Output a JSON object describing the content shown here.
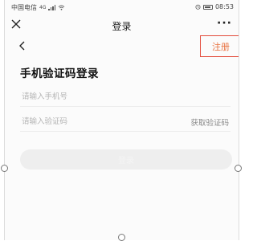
{
  "status_bar": {
    "carrier": "中国电信",
    "network": "4G",
    "time": "08:53"
  },
  "title_bar": {
    "title": "登录",
    "more": "···"
  },
  "nav": {
    "register": "注册"
  },
  "form": {
    "heading": "手机验证码登录",
    "phone_placeholder": "请输入手机号",
    "code_placeholder": "请输入验证码",
    "get_code": "获取验证码",
    "login": "登录"
  },
  "colors": {
    "register_text": "#e8703e",
    "highlight_border": "#e34b3b",
    "button_disabled": "#eeeeee"
  }
}
